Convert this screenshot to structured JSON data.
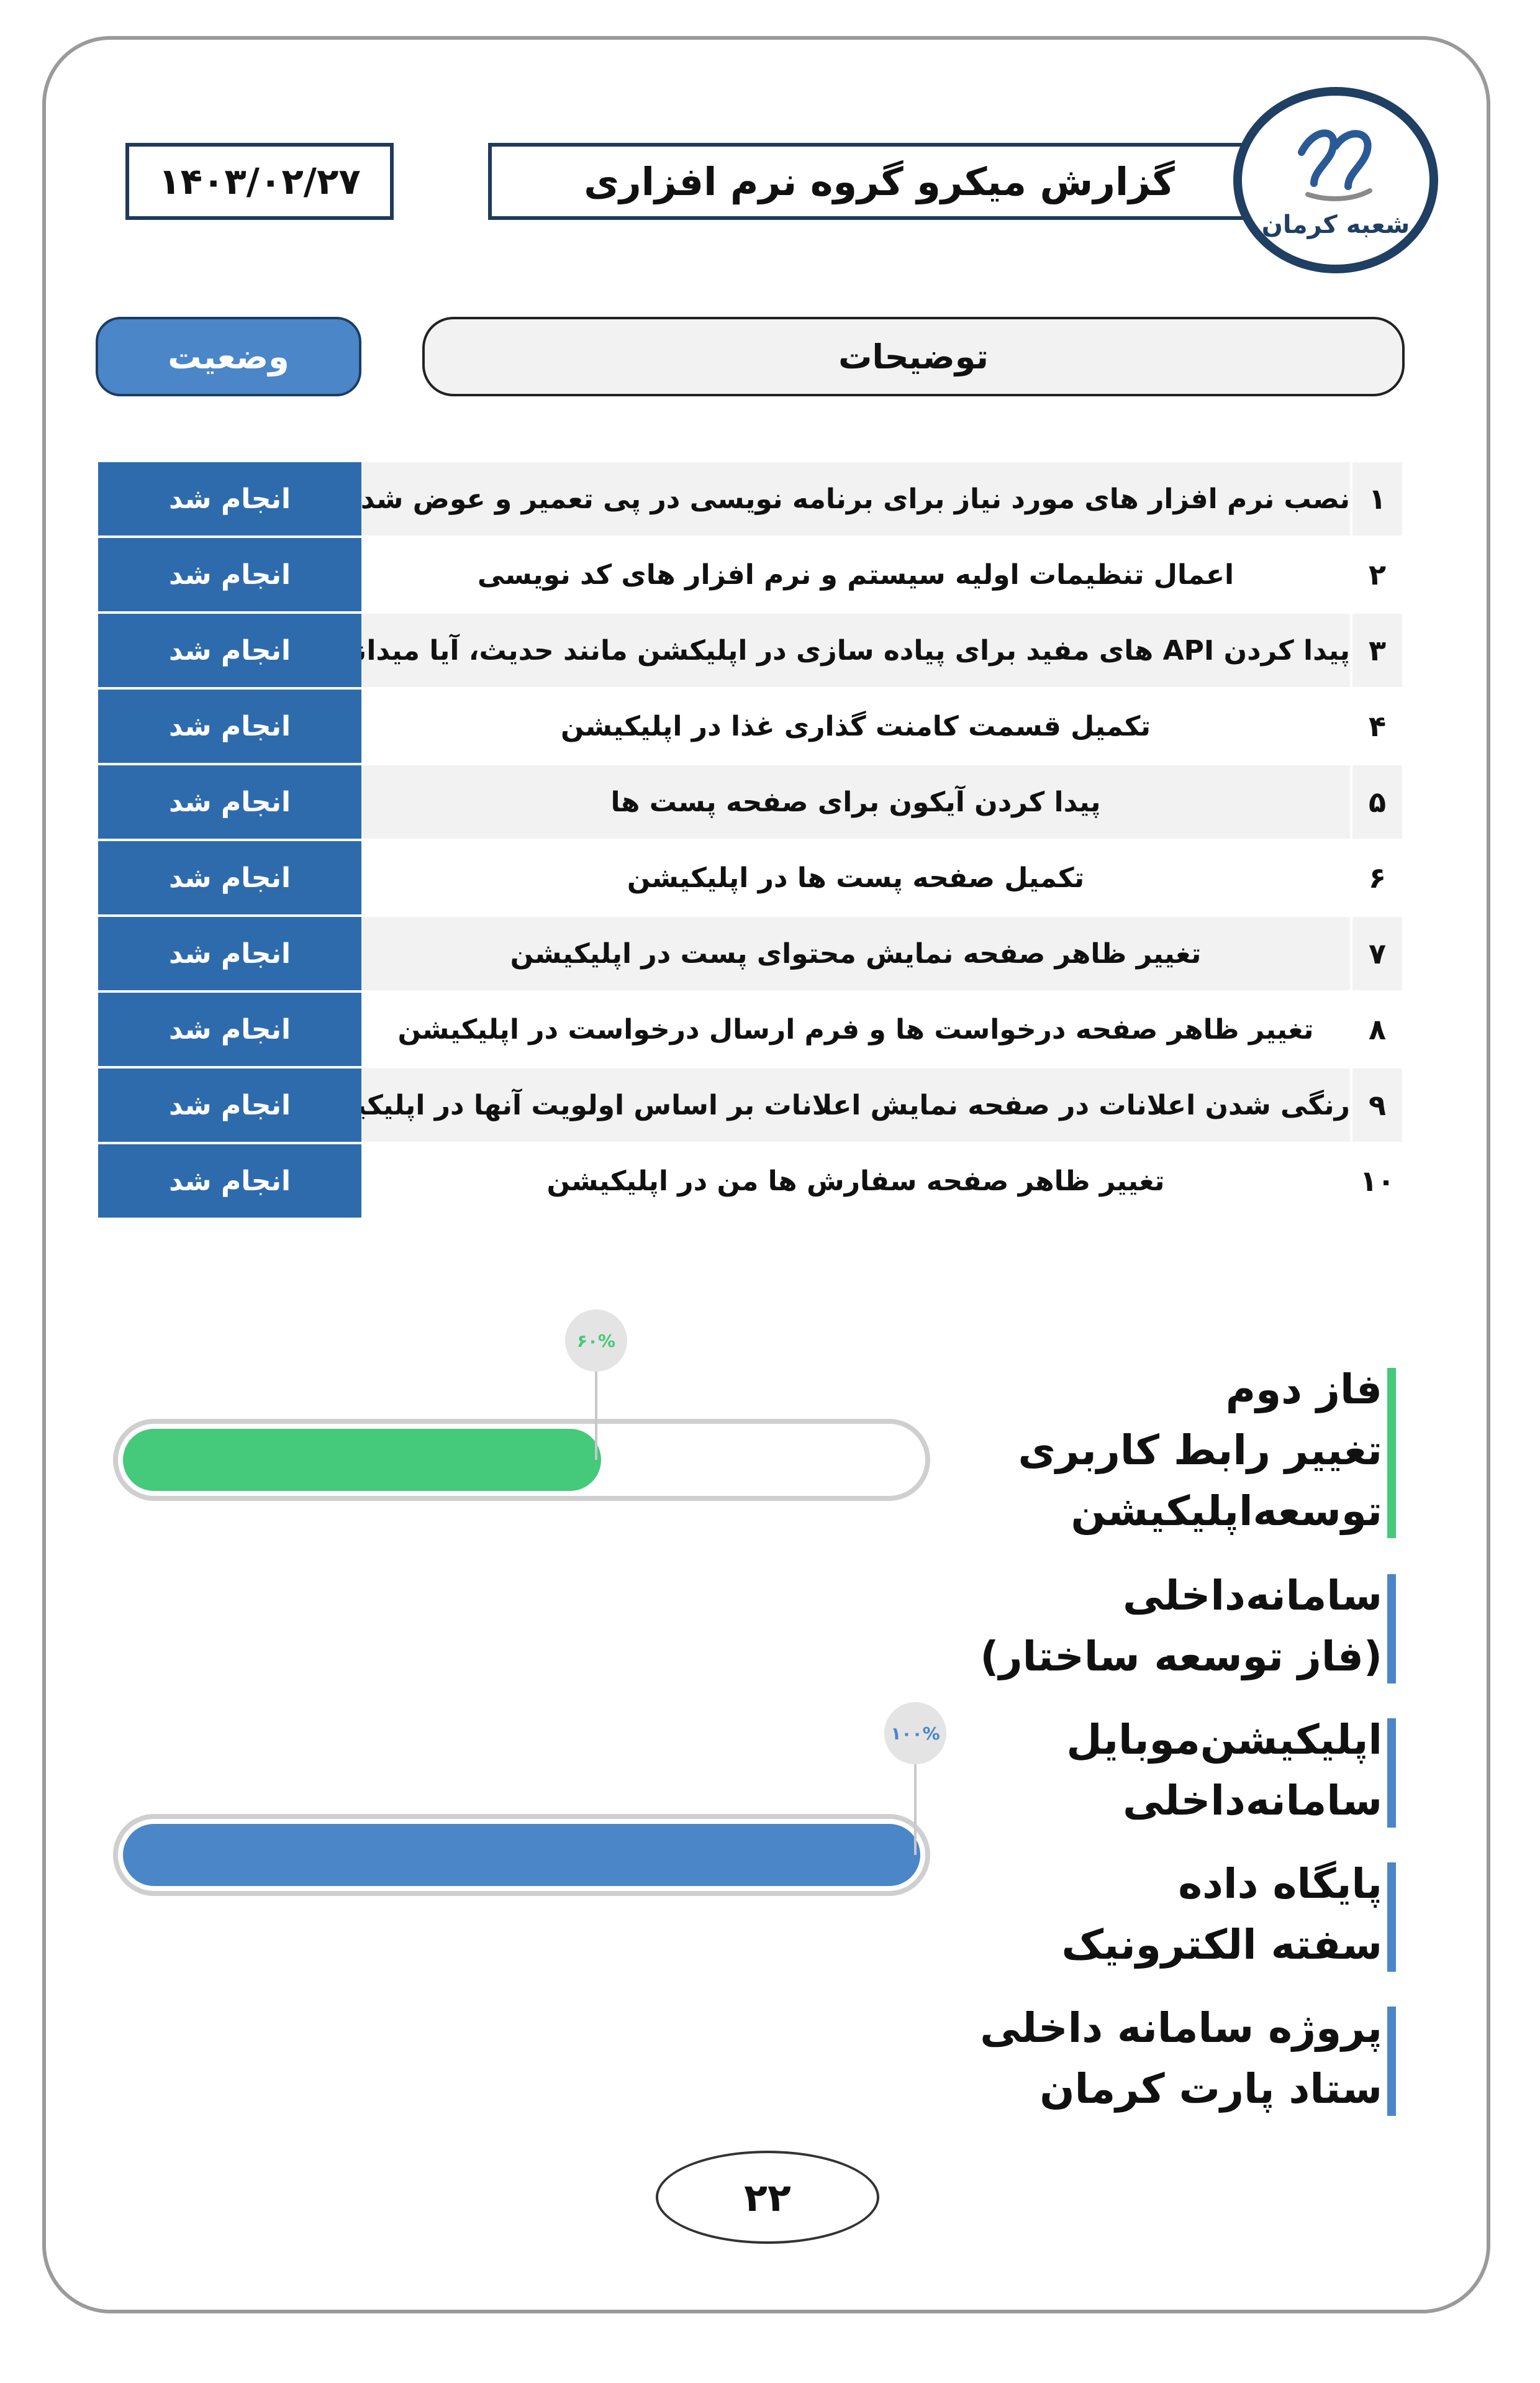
{
  "header": {
    "date": "۱۴۰۳/۰۲/۲۷",
    "title": "گزارش میکرو گروه نرم افزاری",
    "logo_text": "شعبه کرمان"
  },
  "columns": {
    "status": "وضعیت",
    "description": "توضیحات"
  },
  "tasks": [
    {
      "num": "۱",
      "desc": "نصب نرم افزار های مورد نیاز برای برنامه نویسی در پی تعمیر و عوض شدن ویندوز سیستم",
      "status": "انجام شد"
    },
    {
      "num": "۲",
      "desc": "اعمال تنظیمات اولیه سیستم و نرم افزار های کد نویسی",
      "status": "انجام شد"
    },
    {
      "num": "۳",
      "desc": "پیدا کردن API های مفید برای پیاده سازی در اپلیکشن مانند حدیث، آیا میدانستید و غیره",
      "status": "انجام شد"
    },
    {
      "num": "۴",
      "desc": "تکمیل قسمت کامنت گذاری غذا در اپلیکیشن",
      "status": "انجام شد"
    },
    {
      "num": "۵",
      "desc": "پیدا کردن آیکون برای صفحه پست ها",
      "status": "انجام شد"
    },
    {
      "num": "۶",
      "desc": "تکمیل صفحه پست ها در اپلیکیشن",
      "status": "انجام شد"
    },
    {
      "num": "۷",
      "desc": "تغییر ظاهر صفحه نمایش محتوای پست در اپلیکیشن",
      "status": "انجام شد"
    },
    {
      "num": "۸",
      "desc": "تغییر ظاهر صفحه درخواست ها و فرم ارسال درخواست در اپلیکیشن",
      "status": "انجام شد"
    },
    {
      "num": "۹",
      "desc": "رنگی شدن اعلانات در صفحه نمایش اعلانات بر اساس اولویت آنها در اپلیکیشن",
      "status": "انجام شد"
    },
    {
      "num": "۱۰",
      "desc": "تغییر ظاهر صفحه سفارش ها من در اپلیکیشن",
      "status": "انجام شد"
    }
  ],
  "progress": [
    {
      "label": "۶۰%",
      "value": 0.6,
      "color": "#45c97a"
    },
    {
      "label": "۱۰۰%",
      "value": 1.0,
      "color": "#4a86c8"
    }
  ],
  "side_items": [
    {
      "lines": [
        "فاز دوم",
        "تغییر رابط کاربری",
        "توسعه‌اپلیکیشن"
      ],
      "bar_color": "#45c97a"
    },
    {
      "lines": [
        "سامانه‌داخلی",
        "(فاز توسعه ساختار)"
      ],
      "bar_color": "#4a86c8"
    },
    {
      "lines": [
        "اپلیکیشن‌موبایل",
        "سامانه‌داخلی"
      ],
      "bar_color": "#4a86c8"
    },
    {
      "lines": [
        "پایگاه داده",
        "سفته الکترونیک"
      ],
      "bar_color": "#4a86c8"
    },
    {
      "lines": [
        "پروژه سامانه داخلی",
        "ستاد پارت کرمان"
      ],
      "bar_color": "#4a86c8"
    }
  ],
  "footer": {
    "page_number": "۲۲"
  }
}
